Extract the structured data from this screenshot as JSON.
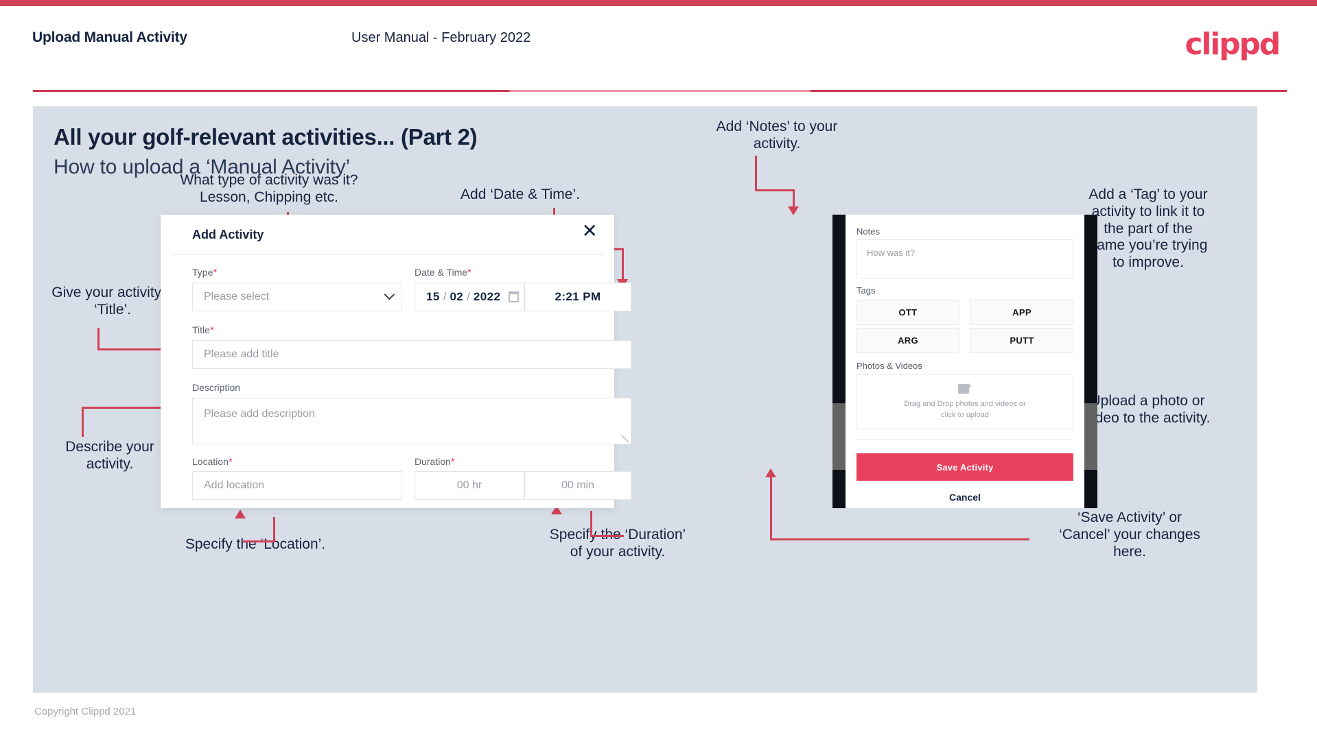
{
  "header": {
    "left_title": "Upload Manual Activity",
    "center_title": "User Manual - February 2022",
    "logo": "clippd"
  },
  "slide": {
    "title": "All your golf-relevant activities... (Part 2)",
    "subtitle": "How to upload a ‘Manual Activity’"
  },
  "annotations": {
    "type": "What type of activity was it?\nLesson, Chipping etc.",
    "date_time": "Add ‘Date & Time’.",
    "title": "Give your activity a\n‘Title’.",
    "description": "Describe your\nactivity.",
    "location": "Specify the ‘Location’.",
    "duration": "Specify the ‘Duration’\nof your activity.",
    "notes": "Add ‘Notes’ to your\nactivity.",
    "tags": "Add a ‘Tag’ to your\nactivity to link it to\nthe part of the\ngame you’re trying\nto improve.",
    "photos": "Upload a photo or\nvideo to the activity.",
    "save_cancel": "‘Save Activity’ or\n‘Cancel’ your changes\nhere."
  },
  "dialog": {
    "title": "Add Activity",
    "close_icon": "close-icon",
    "fields": {
      "type": {
        "label": "Type",
        "required": "*",
        "placeholder": "Please select",
        "chevron_icon": "chevron-down-icon"
      },
      "date_time": {
        "label": "Date & Time",
        "required": "*",
        "day": "15",
        "month": "02",
        "year": "2022",
        "separator": "/",
        "calendar_icon": "calendar-icon",
        "time": "2:21 PM"
      },
      "title": {
        "label": "Title",
        "required": "*",
        "placeholder": "Please add title"
      },
      "description": {
        "label": "Description",
        "required": "",
        "placeholder": "Please add description"
      },
      "location": {
        "label": "Location",
        "required": "*",
        "placeholder": "Add location"
      },
      "duration": {
        "label": "Duration",
        "required": "*",
        "hours_placeholder": "00 hr",
        "minutes_placeholder": "00 min"
      }
    }
  },
  "phone": {
    "notes": {
      "label": "Notes",
      "placeholder": "How was it?"
    },
    "tags": {
      "label": "Tags",
      "items": [
        "OTT",
        "APP",
        "ARG",
        "PUTT"
      ]
    },
    "photos": {
      "label": "Photos & Videos",
      "upload_icon": "add-image-icon",
      "line1": "Drag and Drop photos and videos or",
      "line2": "click to upload"
    },
    "save_label": "Save Activity",
    "cancel_label": "Cancel"
  },
  "footer": {
    "copyright": "Copyright Clippd 2021"
  },
  "colors": {
    "brand_pink": "#e8405e",
    "accent_line": "#cf4257",
    "slide_bg": "#d8dee7",
    "text_dark": "#16233f"
  }
}
